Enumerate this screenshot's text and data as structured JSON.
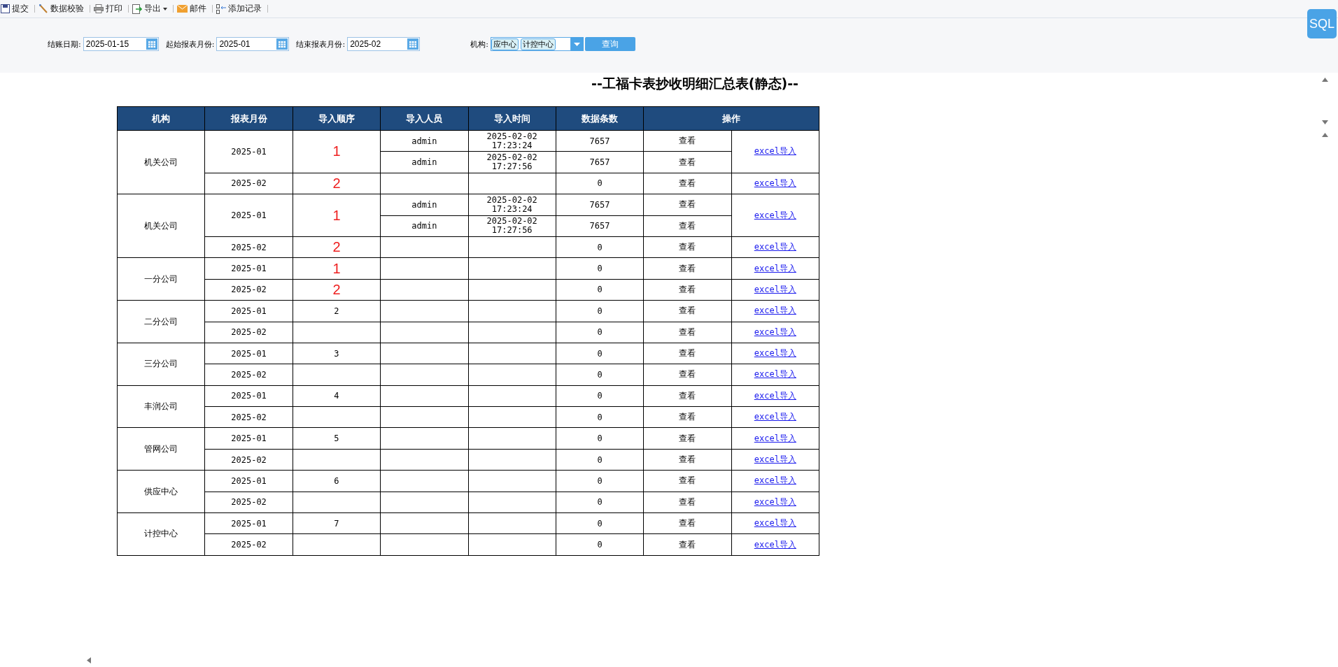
{
  "toolbar": [
    {
      "label": "提交",
      "dropdown": false
    },
    {
      "label": "数据校验",
      "dropdown": false
    },
    {
      "label": "打印",
      "dropdown": false
    },
    {
      "label": "导出",
      "dropdown": true
    },
    {
      "label": "邮件",
      "dropdown": false
    },
    {
      "label": "添加记录",
      "dropdown": false
    }
  ],
  "sql_badge": "SQL",
  "filters": {
    "closing_date": {
      "label": "结账日期:",
      "value": "2025-01-15"
    },
    "start_month": {
      "label": "起始报表月份:",
      "value": "2025-01"
    },
    "end_month": {
      "label": "结束报表月份:",
      "value": "2025-02"
    },
    "org": {
      "label": "机构:",
      "tags": [
        "应中心",
        "计控中心"
      ]
    },
    "query_button": "查询"
  },
  "report": {
    "title": "--工福卡表抄收明细汇总表(静态)--",
    "columns": [
      "机构",
      "报表月份",
      "导入顺序",
      "导入人员",
      "导入时间",
      "数据条数",
      "操作"
    ],
    "groups": [
      {
        "org": "机关公司",
        "months": [
          {
            "month": "2025-01",
            "order": "1",
            "kind": "handwritten",
            "link": "excel导入",
            "entries": [
              {
                "user": "admin",
                "time": "2025-02-02 17:23:24",
                "count": "7657",
                "action": "查看"
              },
              {
                "user": "admin",
                "time": "2025-02-02 17:27:56",
                "count": "7657",
                "action": "查看"
              }
            ]
          },
          {
            "month": "2025-02",
            "order": "2",
            "kind": "handwritten",
            "link": "excel导入",
            "entries": [
              {
                "count": "0",
                "action": "查看"
              }
            ]
          }
        ]
      },
      {
        "org": "机关公司",
        "months": [
          {
            "month": "2025-01",
            "order": "1",
            "kind": "handwritten",
            "link": "excel导入",
            "entries": [
              {
                "user": "admin",
                "time": "2025-02-02 17:23:24",
                "count": "7657",
                "action": "查看"
              },
              {
                "user": "admin",
                "time": "2025-02-02 17:27:56",
                "count": "7657",
                "action": "查看"
              }
            ]
          },
          {
            "month": "2025-02",
            "order": "2",
            "kind": "handwritten",
            "link": "excel导入",
            "entries": [
              {
                "count": "0",
                "action": "查看"
              }
            ]
          }
        ]
      },
      {
        "org": "一分公司",
        "months": [
          {
            "month": "2025-01",
            "order": "1",
            "kind": "handwritten",
            "link": "excel导入",
            "entries": [
              {
                "count": "0",
                "action": "查看"
              }
            ]
          },
          {
            "month": "2025-02",
            "order": "2",
            "kind": "handwritten",
            "link": "excel导入",
            "entries": [
              {
                "count": "0",
                "action": "查看"
              }
            ]
          }
        ]
      },
      {
        "org": "二分公司",
        "months": [
          {
            "month": "2025-01",
            "order": "2",
            "kind": "printed",
            "link": "excel导入",
            "entries": [
              {
                "count": "0",
                "action": "查看"
              }
            ]
          },
          {
            "month": "2025-02",
            "link": "excel导入",
            "entries": [
              {
                "count": "0",
                "action": "查看"
              }
            ]
          }
        ]
      },
      {
        "org": "三分公司",
        "months": [
          {
            "month": "2025-01",
            "order": "3",
            "kind": "printed",
            "link": "excel导入",
            "entries": [
              {
                "count": "0",
                "action": "查看"
              }
            ]
          },
          {
            "month": "2025-02",
            "link": "excel导入",
            "entries": [
              {
                "count": "0",
                "action": "查看"
              }
            ]
          }
        ]
      },
      {
        "org": "丰润公司",
        "months": [
          {
            "month": "2025-01",
            "order": "4",
            "kind": "printed",
            "link": "excel导入",
            "entries": [
              {
                "count": "0",
                "action": "查看"
              }
            ]
          },
          {
            "month": "2025-02",
            "link": "excel导入",
            "entries": [
              {
                "count": "0",
                "action": "查看"
              }
            ]
          }
        ]
      },
      {
        "org": "管网公司",
        "months": [
          {
            "month": "2025-01",
            "order": "5",
            "kind": "printed",
            "link": "excel导入",
            "entries": [
              {
                "count": "0",
                "action": "查看"
              }
            ]
          },
          {
            "month": "2025-02",
            "link": "excel导入",
            "entries": [
              {
                "count": "0",
                "action": "查看"
              }
            ]
          }
        ]
      },
      {
        "org": "供应中心",
        "months": [
          {
            "month": "2025-01",
            "order": "6",
            "kind": "printed",
            "link": "excel导入",
            "entries": [
              {
                "count": "0",
                "action": "查看"
              }
            ]
          },
          {
            "month": "2025-02",
            "link": "excel导入",
            "entries": [
              {
                "count": "0",
                "action": "查看"
              }
            ]
          }
        ]
      },
      {
        "org": "计控中心",
        "months": [
          {
            "month": "2025-01",
            "order": "7",
            "kind": "printed",
            "link": "excel导入",
            "entries": [
              {
                "count": "0",
                "action": "查看"
              }
            ]
          },
          {
            "month": "2025-02",
            "link": "excel导入",
            "entries": [
              {
                "count": "0",
                "action": "查看"
              }
            ]
          }
        ]
      }
    ]
  }
}
